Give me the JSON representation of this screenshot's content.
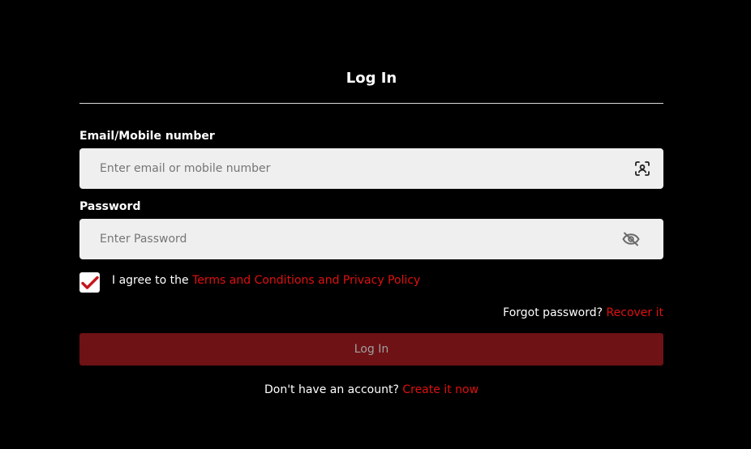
{
  "header": {
    "title": "Log In"
  },
  "email": {
    "label": "Email/Mobile number",
    "placeholder": "Enter email or mobile number",
    "value": "",
    "icon": "face-scan-icon"
  },
  "password": {
    "label": "Password",
    "placeholder": "Enter Password",
    "value": "",
    "icon": "eye-off-icon"
  },
  "agreement": {
    "checked": true,
    "text": "I agree to the ",
    "link_text": "Terms and Conditions and Privacy Policy"
  },
  "forgot": {
    "text": "Forgot password? ",
    "link_text": "Recover it"
  },
  "submit": {
    "label": "Log In"
  },
  "signup": {
    "text": "Don't have an account? ",
    "link_text": "Create it now"
  },
  "colors": {
    "background": "#000000",
    "accent": "#e01010",
    "button_bg": "#6e1215",
    "input_bg": "#efefef"
  }
}
